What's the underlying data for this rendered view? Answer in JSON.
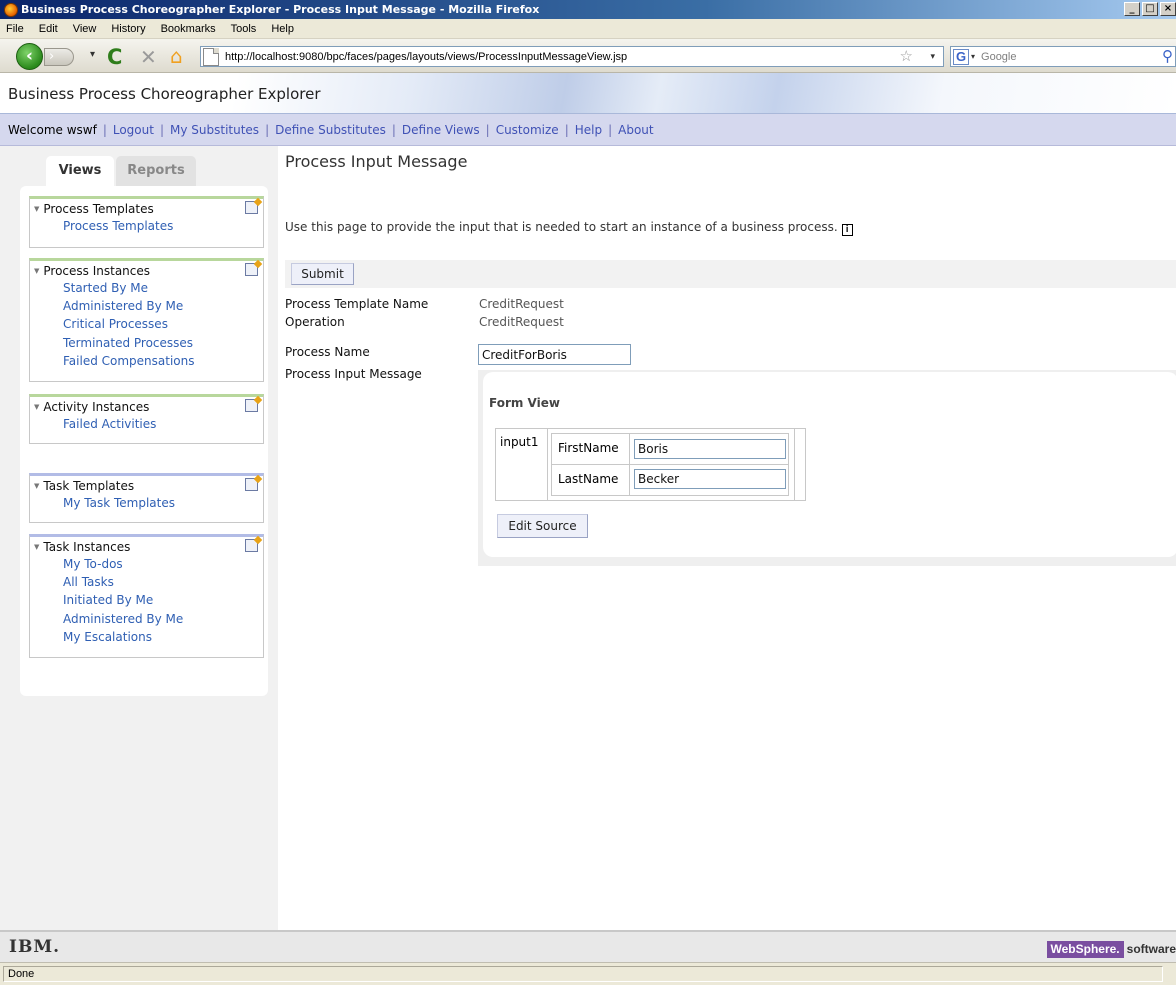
{
  "window": {
    "title": "Business Process Choreographer Explorer - Process Input Message - Mozilla Firefox",
    "min": "_",
    "max": "□",
    "close": "×"
  },
  "menu": [
    "File",
    "Edit",
    "View",
    "History",
    "Bookmarks",
    "Tools",
    "Help"
  ],
  "nav": {
    "back_icon": "‹",
    "forward_icon": "›",
    "dropdown": "▾",
    "reload_icon": "C",
    "stop_icon": "✕",
    "home_icon": "⌂",
    "url": "http://localhost:9080/bpc/faces/pages/layouts/views/ProcessInputMessageView.jsp",
    "bookmark_star": "☆",
    "search_engine": "G",
    "search_placeholder": "Google",
    "search_icon": "⚲"
  },
  "app": {
    "title": "Business Process Choreographer Explorer"
  },
  "welcome_bar": {
    "welcome": "Welcome wswf",
    "links": [
      "Logout",
      "My Substitutes",
      "Define Substitutes",
      "Define Views",
      "Customize",
      "Help",
      "About"
    ],
    "separator": "|"
  },
  "sidebar": {
    "tabs": {
      "views": "Views",
      "reports": "Reports"
    },
    "expand_icon": "▼",
    "groups": [
      {
        "title": "Process Templates",
        "items": [
          "Process Templates"
        ]
      },
      {
        "title": "Process Instances",
        "items": [
          "Started By Me",
          "Administered By Me",
          "Critical Processes",
          "Terminated Processes",
          "Failed Compensations"
        ]
      },
      {
        "title": "Activity Instances",
        "items": [
          "Failed Activities"
        ]
      },
      {
        "title": "Task Templates",
        "items": [
          "My Task Templates"
        ]
      },
      {
        "title": "Task Instances",
        "items": [
          "My To-dos",
          "All Tasks",
          "Initiated By Me",
          "Administered By Me",
          "My Escalations"
        ]
      }
    ]
  },
  "main": {
    "page_title": "Process Input Message",
    "description": "Use this page to provide the input that is needed to start an instance of a business process.",
    "info_icon": "i",
    "submit_label": "Submit",
    "fields": {
      "template_name_label": "Process Template Name",
      "template_name_value": "CreditRequest",
      "operation_label": "Operation",
      "operation_value": "CreditRequest",
      "process_name_label": "Process Name",
      "process_name_value": "CreditForBoris",
      "input_message_label": "Process Input Message"
    },
    "form": {
      "title": "Form View",
      "part_name": "input1",
      "rows": [
        {
          "label": "FirstName",
          "value": "Boris"
        },
        {
          "label": "LastName",
          "value": "Becker"
        }
      ],
      "edit_source_label": "Edit Source"
    }
  },
  "footer": {
    "ibm": "IBM.",
    "websphere": "WebSphere.",
    "software": "software"
  },
  "status": {
    "text": "Done"
  }
}
